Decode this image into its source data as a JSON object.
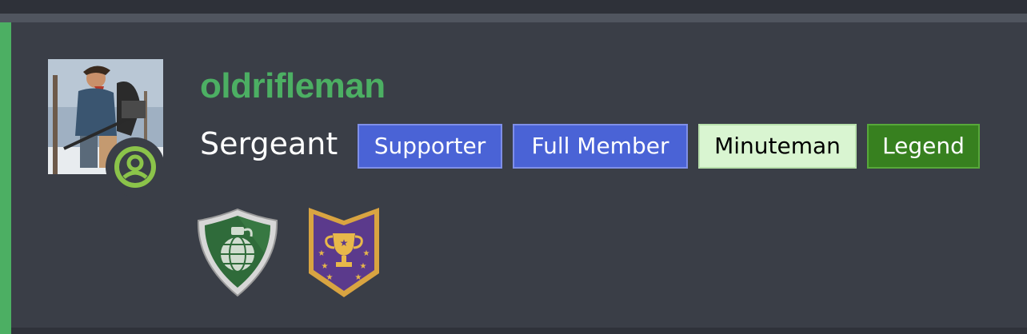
{
  "user": {
    "username": "oldrifleman",
    "rank": "Sergeant",
    "username_color": "#4caf63",
    "avatar": "user-avatar-photo",
    "status_icon": "user-circle-icon"
  },
  "tags": [
    {
      "label": "Supporter",
      "bg": "#4a63d6",
      "text_color": "#ffffff"
    },
    {
      "label": "Full Member",
      "bg": "#4a63d6",
      "text_color": "#ffffff"
    },
    {
      "label": "Minuteman",
      "bg": "#d9f5d1",
      "text_color": "#000000"
    },
    {
      "label": "Legend",
      "bg": "#37801f",
      "text_color": "#ffffff"
    }
  ],
  "awards": [
    {
      "icon": "grenade-shield-icon",
      "colors": [
        "#2f6b3a",
        "#c8c8c8"
      ]
    },
    {
      "icon": "trophy-shield-icon",
      "colors": [
        "#5b3a8c",
        "#d9a441"
      ]
    }
  ],
  "theme": {
    "background": "#3a3e47",
    "accent": "#4caf63"
  }
}
